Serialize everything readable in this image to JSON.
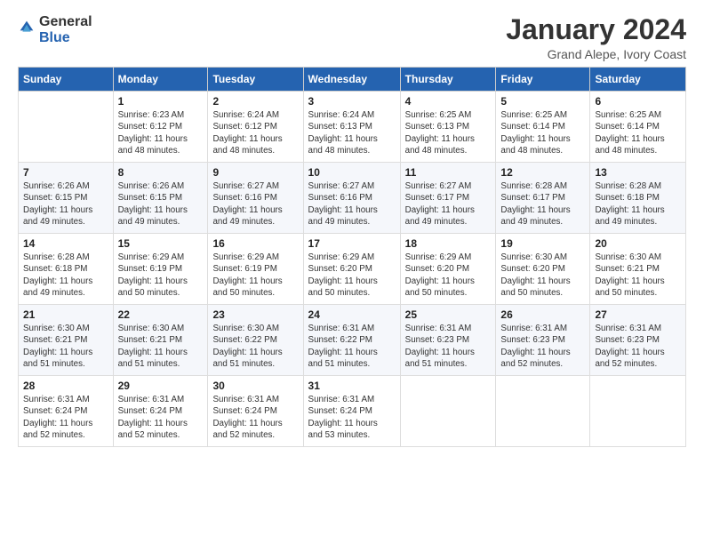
{
  "logo": {
    "text1": "General",
    "text2": "Blue"
  },
  "title": "January 2024",
  "subtitle": "Grand Alepe, Ivory Coast",
  "days_of_week": [
    "Sunday",
    "Monday",
    "Tuesday",
    "Wednesday",
    "Thursday",
    "Friday",
    "Saturday"
  ],
  "weeks": [
    [
      {
        "day": "",
        "info": ""
      },
      {
        "day": "1",
        "info": "Sunrise: 6:23 AM\nSunset: 6:12 PM\nDaylight: 11 hours\nand 48 minutes."
      },
      {
        "day": "2",
        "info": "Sunrise: 6:24 AM\nSunset: 6:12 PM\nDaylight: 11 hours\nand 48 minutes."
      },
      {
        "day": "3",
        "info": "Sunrise: 6:24 AM\nSunset: 6:13 PM\nDaylight: 11 hours\nand 48 minutes."
      },
      {
        "day": "4",
        "info": "Sunrise: 6:25 AM\nSunset: 6:13 PM\nDaylight: 11 hours\nand 48 minutes."
      },
      {
        "day": "5",
        "info": "Sunrise: 6:25 AM\nSunset: 6:14 PM\nDaylight: 11 hours\nand 48 minutes."
      },
      {
        "day": "6",
        "info": "Sunrise: 6:25 AM\nSunset: 6:14 PM\nDaylight: 11 hours\nand 48 minutes."
      }
    ],
    [
      {
        "day": "7",
        "info": "Sunrise: 6:26 AM\nSunset: 6:15 PM\nDaylight: 11 hours\nand 49 minutes."
      },
      {
        "day": "8",
        "info": "Sunrise: 6:26 AM\nSunset: 6:15 PM\nDaylight: 11 hours\nand 49 minutes."
      },
      {
        "day": "9",
        "info": "Sunrise: 6:27 AM\nSunset: 6:16 PM\nDaylight: 11 hours\nand 49 minutes."
      },
      {
        "day": "10",
        "info": "Sunrise: 6:27 AM\nSunset: 6:16 PM\nDaylight: 11 hours\nand 49 minutes."
      },
      {
        "day": "11",
        "info": "Sunrise: 6:27 AM\nSunset: 6:17 PM\nDaylight: 11 hours\nand 49 minutes."
      },
      {
        "day": "12",
        "info": "Sunrise: 6:28 AM\nSunset: 6:17 PM\nDaylight: 11 hours\nand 49 minutes."
      },
      {
        "day": "13",
        "info": "Sunrise: 6:28 AM\nSunset: 6:18 PM\nDaylight: 11 hours\nand 49 minutes."
      }
    ],
    [
      {
        "day": "14",
        "info": "Sunrise: 6:28 AM\nSunset: 6:18 PM\nDaylight: 11 hours\nand 49 minutes."
      },
      {
        "day": "15",
        "info": "Sunrise: 6:29 AM\nSunset: 6:19 PM\nDaylight: 11 hours\nand 50 minutes."
      },
      {
        "day": "16",
        "info": "Sunrise: 6:29 AM\nSunset: 6:19 PM\nDaylight: 11 hours\nand 50 minutes."
      },
      {
        "day": "17",
        "info": "Sunrise: 6:29 AM\nSunset: 6:20 PM\nDaylight: 11 hours\nand 50 minutes."
      },
      {
        "day": "18",
        "info": "Sunrise: 6:29 AM\nSunset: 6:20 PM\nDaylight: 11 hours\nand 50 minutes."
      },
      {
        "day": "19",
        "info": "Sunrise: 6:30 AM\nSunset: 6:20 PM\nDaylight: 11 hours\nand 50 minutes."
      },
      {
        "day": "20",
        "info": "Sunrise: 6:30 AM\nSunset: 6:21 PM\nDaylight: 11 hours\nand 50 minutes."
      }
    ],
    [
      {
        "day": "21",
        "info": "Sunrise: 6:30 AM\nSunset: 6:21 PM\nDaylight: 11 hours\nand 51 minutes."
      },
      {
        "day": "22",
        "info": "Sunrise: 6:30 AM\nSunset: 6:21 PM\nDaylight: 11 hours\nand 51 minutes."
      },
      {
        "day": "23",
        "info": "Sunrise: 6:30 AM\nSunset: 6:22 PM\nDaylight: 11 hours\nand 51 minutes."
      },
      {
        "day": "24",
        "info": "Sunrise: 6:31 AM\nSunset: 6:22 PM\nDaylight: 11 hours\nand 51 minutes."
      },
      {
        "day": "25",
        "info": "Sunrise: 6:31 AM\nSunset: 6:23 PM\nDaylight: 11 hours\nand 51 minutes."
      },
      {
        "day": "26",
        "info": "Sunrise: 6:31 AM\nSunset: 6:23 PM\nDaylight: 11 hours\nand 52 minutes."
      },
      {
        "day": "27",
        "info": "Sunrise: 6:31 AM\nSunset: 6:23 PM\nDaylight: 11 hours\nand 52 minutes."
      }
    ],
    [
      {
        "day": "28",
        "info": "Sunrise: 6:31 AM\nSunset: 6:24 PM\nDaylight: 11 hours\nand 52 minutes."
      },
      {
        "day": "29",
        "info": "Sunrise: 6:31 AM\nSunset: 6:24 PM\nDaylight: 11 hours\nand 52 minutes."
      },
      {
        "day": "30",
        "info": "Sunrise: 6:31 AM\nSunset: 6:24 PM\nDaylight: 11 hours\nand 52 minutes."
      },
      {
        "day": "31",
        "info": "Sunrise: 6:31 AM\nSunset: 6:24 PM\nDaylight: 11 hours\nand 53 minutes."
      },
      {
        "day": "",
        "info": ""
      },
      {
        "day": "",
        "info": ""
      },
      {
        "day": "",
        "info": ""
      }
    ]
  ]
}
